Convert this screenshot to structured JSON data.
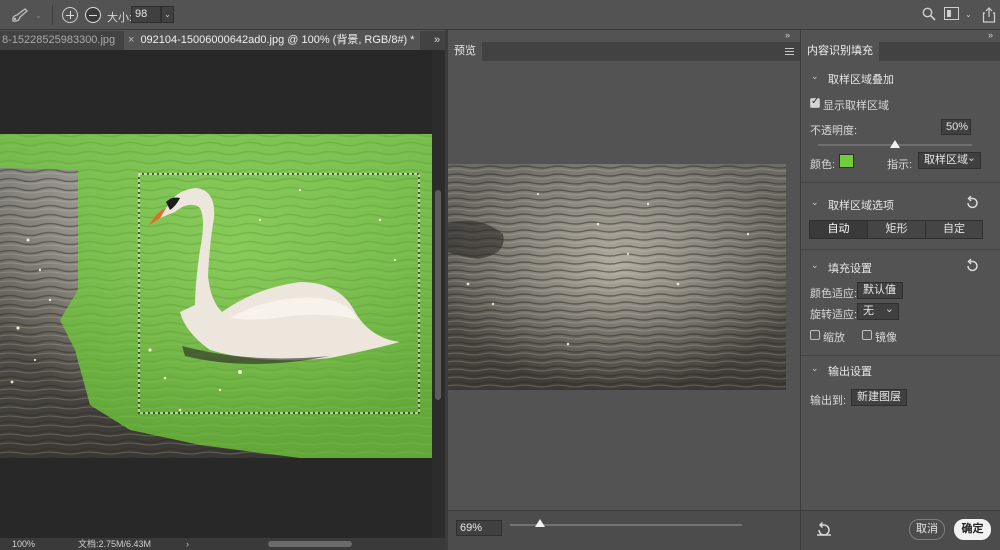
{
  "options_bar": {
    "size_label": "大小:",
    "size_value": "98"
  },
  "tabs": [
    {
      "title": "8-15228525983300.jpg",
      "active": false
    },
    {
      "title": "092104-15006000642ad0.jpg @ 100% (背景, RGB/8#) *",
      "active": true
    }
  ],
  "tabs_more": "»",
  "status_bar": {
    "zoom": "100%",
    "doc_size": "文档:2.75M/6.43M",
    "arrow": "›"
  },
  "preview": {
    "tab_title": "预览",
    "zoom_value": "69%",
    "zoom_slider_level": 0.13
  },
  "panel": {
    "tab_title": "内容识别填充",
    "overlay_section": {
      "title": "取样区域叠加",
      "show_sampling_label": "显示取样区域",
      "show_sampling_checked": true,
      "opacity_label": "不透明度:",
      "opacity_value": "50%",
      "opacity_level": 0.5,
      "color_label": "颜色:",
      "color_hex": "#72cc3c",
      "indicate_label": "指示:",
      "indicate_value": "取样区域"
    },
    "sampling_section": {
      "title": "取样区域选项",
      "options": [
        "自动",
        "矩形",
        "自定"
      ],
      "selected": "自动"
    },
    "fill_section": {
      "title": "填充设置",
      "color_adapt_label": "颜色适应:",
      "color_adapt_value": "默认值",
      "rotation_adapt_label": "旋转适应:",
      "rotation_adapt_value": "无",
      "scale_label": "缩放",
      "scale_checked": false,
      "mirror_label": "镜像",
      "mirror_checked": false
    },
    "output_section": {
      "title": "输出设置",
      "output_label": "输出到:",
      "output_value": "新建图层"
    },
    "cancel_label": "取消",
    "ok_label": "确定"
  }
}
